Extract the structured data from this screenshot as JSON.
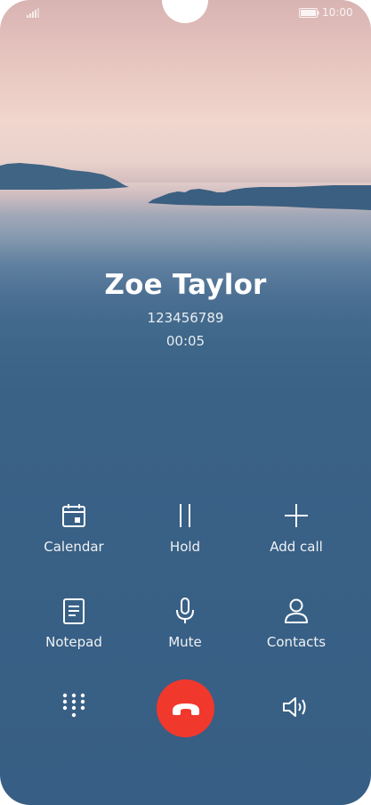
{
  "status_bar": {
    "time": "10:00"
  },
  "caller": {
    "name": "Zoe Taylor",
    "number": "123456789",
    "duration": "00:05"
  },
  "actions": {
    "calendar": "Calendar",
    "hold": "Hold",
    "add_call": "Add call",
    "notepad": "Notepad",
    "mute": "Mute",
    "contacts": "Contacts"
  },
  "icons": {
    "signal": "signal-bars-icon",
    "battery": "battery-icon",
    "calendar": "calendar-icon",
    "hold": "pause-icon",
    "add_call": "plus-icon",
    "notepad": "notepad-icon",
    "mute": "microphone-icon",
    "contacts": "person-icon",
    "keypad": "dialpad-icon",
    "end_call": "hang-up-icon",
    "speaker": "speaker-icon"
  },
  "colors": {
    "end_call": "#f1382d",
    "background": "#375e84"
  }
}
